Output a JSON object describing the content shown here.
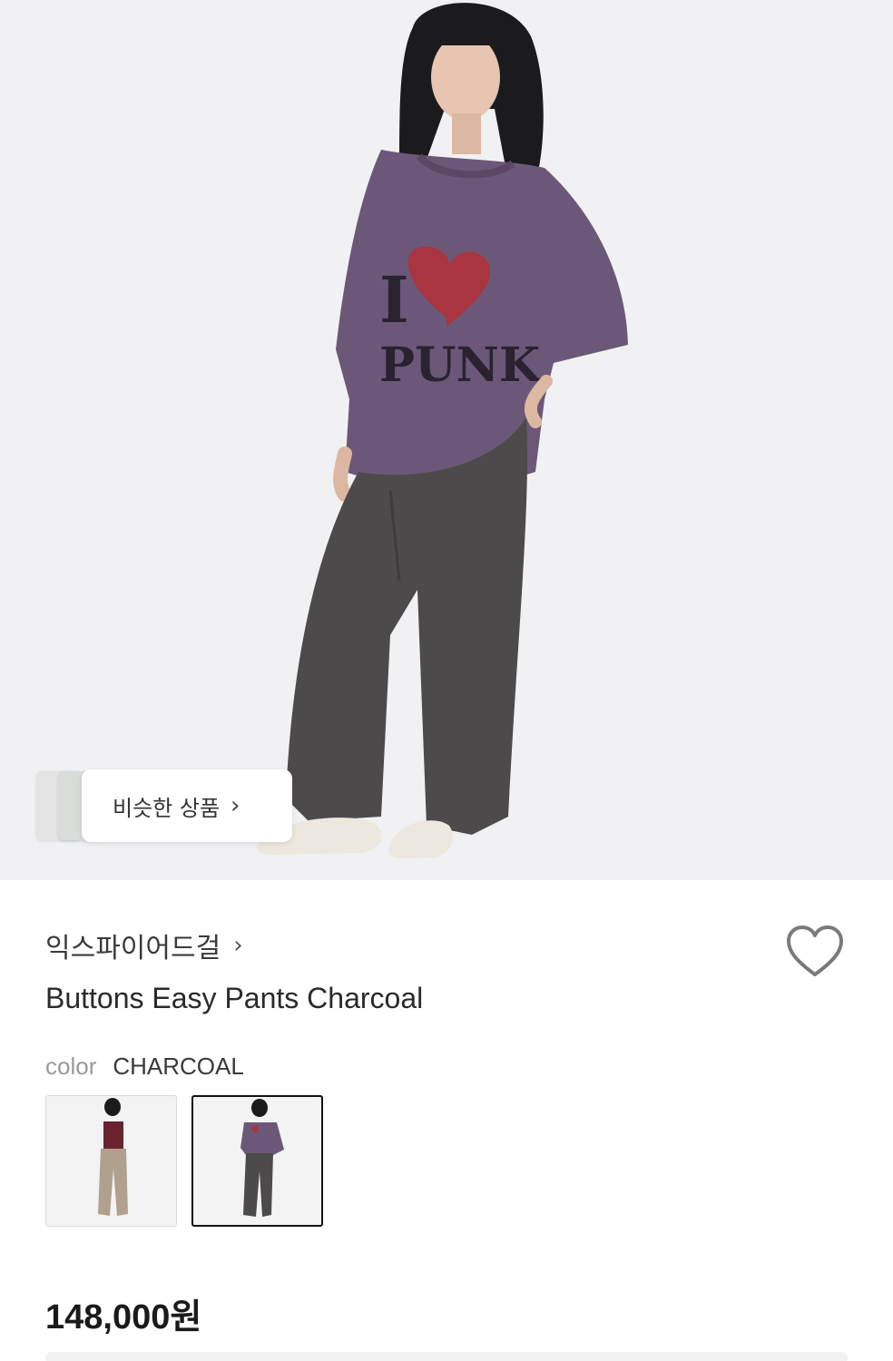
{
  "hero": {
    "icon": "product-photo",
    "similar_products_label": "비슷한 상품",
    "similar_products_chevron": "›"
  },
  "product": {
    "brand": "익스파이어드걸",
    "brand_chevron": "›",
    "title": "Buttons Easy Pants Charcoal",
    "color_key": "color",
    "color_value": "CHARCOAL",
    "swatches": [
      {
        "name": "beige-variant",
        "selected": false
      },
      {
        "name": "charcoal-variant",
        "selected": true
      }
    ],
    "price": "148,000원"
  },
  "colors": {
    "shirt": "#6b5878",
    "pants": "#4d4a4c",
    "heart": "#a8353f",
    "background": "#f1f1f3"
  }
}
